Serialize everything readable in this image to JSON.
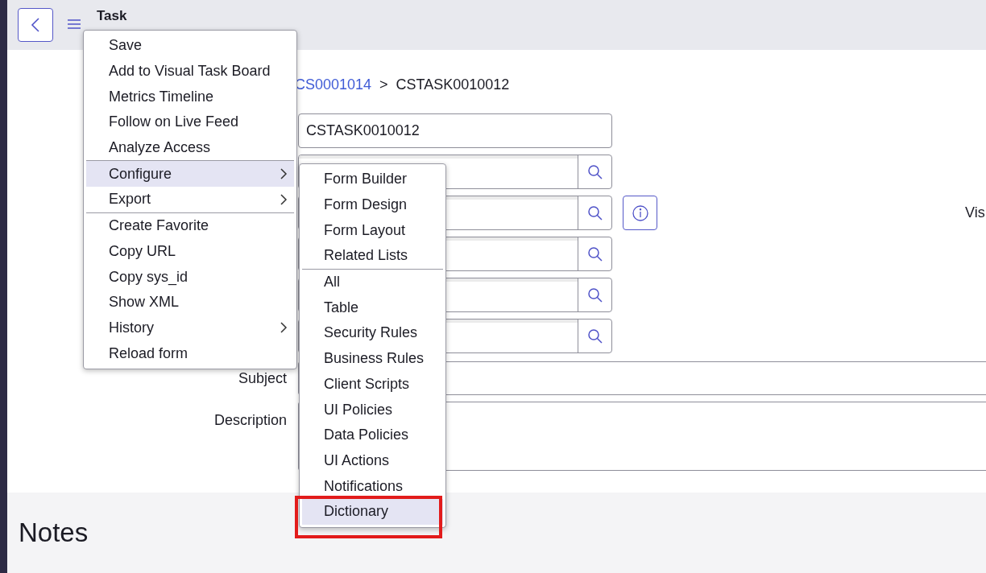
{
  "header": {
    "title": "Task"
  },
  "breadcrumb": [
    {
      "label": "CS0001014",
      "kind": "link"
    },
    {
      "label": ">",
      "kind": "separator"
    },
    {
      "label": "CSTASK0010012",
      "kind": "current"
    }
  ],
  "form": {
    "number": {
      "value": "CSTASK0010012"
    },
    "reference_fields": [
      {
        "kind": "plain"
      },
      {
        "kind": "with_info"
      },
      {
        "kind": "plain"
      },
      {
        "kind": "plain"
      },
      {
        "kind": "plain"
      }
    ],
    "side_label": "Vis",
    "subject": {
      "label": "Subject"
    },
    "description": {
      "label": "Description"
    }
  },
  "notes": {
    "title": "Notes"
  },
  "context_menu": {
    "groups": [
      [
        {
          "label": "Save",
          "submenu": false,
          "selected": false
        },
        {
          "label": "Add to Visual Task Board",
          "submenu": false,
          "selected": false
        },
        {
          "label": "Metrics Timeline",
          "submenu": false,
          "selected": false
        },
        {
          "label": "Follow on Live Feed",
          "submenu": false,
          "selected": false
        },
        {
          "label": "Analyze Access",
          "submenu": false,
          "selected": false
        }
      ],
      [
        {
          "label": "Configure",
          "submenu": true,
          "selected": true
        },
        {
          "label": "Export",
          "submenu": true,
          "selected": false
        }
      ],
      [
        {
          "label": "Create Favorite",
          "submenu": false,
          "selected": false
        },
        {
          "label": "Copy URL",
          "submenu": false,
          "selected": false
        },
        {
          "label": "Copy sys_id",
          "submenu": false,
          "selected": false
        },
        {
          "label": "Show XML",
          "submenu": false,
          "selected": false
        },
        {
          "label": "History",
          "submenu": true,
          "selected": false
        },
        {
          "label": "Reload form",
          "submenu": false,
          "selected": false
        }
      ]
    ]
  },
  "submenu": {
    "groups": [
      [
        {
          "label": "Form Builder",
          "selected": false
        },
        {
          "label": "Form Design",
          "selected": false
        },
        {
          "label": "Form Layout",
          "selected": false
        },
        {
          "label": "Related Lists",
          "selected": false
        }
      ],
      [
        {
          "label": "All",
          "selected": false
        },
        {
          "label": "Table",
          "selected": false
        },
        {
          "label": "Security Rules",
          "selected": false
        },
        {
          "label": "Business Rules",
          "selected": false
        },
        {
          "label": "Client Scripts",
          "selected": false
        },
        {
          "label": "UI Policies",
          "selected": false
        },
        {
          "label": "Data Policies",
          "selected": false
        },
        {
          "label": "UI Actions",
          "selected": false
        },
        {
          "label": "Notifications",
          "selected": false
        },
        {
          "label": "Dictionary",
          "selected": true
        }
      ]
    ]
  },
  "highlight_annotation": true
}
